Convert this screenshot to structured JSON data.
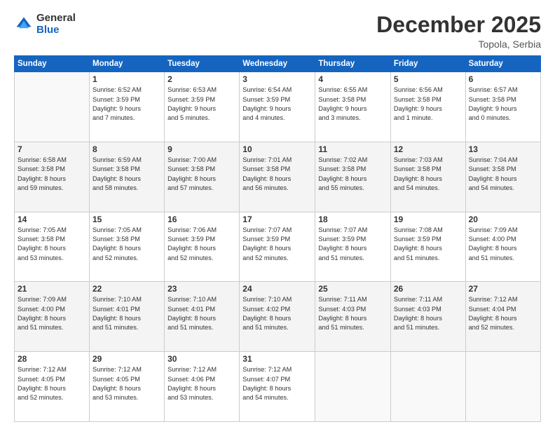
{
  "logo": {
    "general": "General",
    "blue": "Blue"
  },
  "title": "December 2025",
  "subtitle": "Topola, Serbia",
  "days_header": [
    "Sunday",
    "Monday",
    "Tuesday",
    "Wednesday",
    "Thursday",
    "Friday",
    "Saturday"
  ],
  "weeks": [
    [
      {
        "num": "",
        "detail": ""
      },
      {
        "num": "1",
        "detail": "Sunrise: 6:52 AM\nSunset: 3:59 PM\nDaylight: 9 hours\nand 7 minutes."
      },
      {
        "num": "2",
        "detail": "Sunrise: 6:53 AM\nSunset: 3:59 PM\nDaylight: 9 hours\nand 5 minutes."
      },
      {
        "num": "3",
        "detail": "Sunrise: 6:54 AM\nSunset: 3:59 PM\nDaylight: 9 hours\nand 4 minutes."
      },
      {
        "num": "4",
        "detail": "Sunrise: 6:55 AM\nSunset: 3:58 PM\nDaylight: 9 hours\nand 3 minutes."
      },
      {
        "num": "5",
        "detail": "Sunrise: 6:56 AM\nSunset: 3:58 PM\nDaylight: 9 hours\nand 1 minute."
      },
      {
        "num": "6",
        "detail": "Sunrise: 6:57 AM\nSunset: 3:58 PM\nDaylight: 9 hours\nand 0 minutes."
      }
    ],
    [
      {
        "num": "7",
        "detail": "Sunrise: 6:58 AM\nSunset: 3:58 PM\nDaylight: 8 hours\nand 59 minutes."
      },
      {
        "num": "8",
        "detail": "Sunrise: 6:59 AM\nSunset: 3:58 PM\nDaylight: 8 hours\nand 58 minutes."
      },
      {
        "num": "9",
        "detail": "Sunrise: 7:00 AM\nSunset: 3:58 PM\nDaylight: 8 hours\nand 57 minutes."
      },
      {
        "num": "10",
        "detail": "Sunrise: 7:01 AM\nSunset: 3:58 PM\nDaylight: 8 hours\nand 56 minutes."
      },
      {
        "num": "11",
        "detail": "Sunrise: 7:02 AM\nSunset: 3:58 PM\nDaylight: 8 hours\nand 55 minutes."
      },
      {
        "num": "12",
        "detail": "Sunrise: 7:03 AM\nSunset: 3:58 PM\nDaylight: 8 hours\nand 54 minutes."
      },
      {
        "num": "13",
        "detail": "Sunrise: 7:04 AM\nSunset: 3:58 PM\nDaylight: 8 hours\nand 54 minutes."
      }
    ],
    [
      {
        "num": "14",
        "detail": "Sunrise: 7:05 AM\nSunset: 3:58 PM\nDaylight: 8 hours\nand 53 minutes."
      },
      {
        "num": "15",
        "detail": "Sunrise: 7:05 AM\nSunset: 3:58 PM\nDaylight: 8 hours\nand 52 minutes."
      },
      {
        "num": "16",
        "detail": "Sunrise: 7:06 AM\nSunset: 3:59 PM\nDaylight: 8 hours\nand 52 minutes."
      },
      {
        "num": "17",
        "detail": "Sunrise: 7:07 AM\nSunset: 3:59 PM\nDaylight: 8 hours\nand 52 minutes."
      },
      {
        "num": "18",
        "detail": "Sunrise: 7:07 AM\nSunset: 3:59 PM\nDaylight: 8 hours\nand 51 minutes."
      },
      {
        "num": "19",
        "detail": "Sunrise: 7:08 AM\nSunset: 3:59 PM\nDaylight: 8 hours\nand 51 minutes."
      },
      {
        "num": "20",
        "detail": "Sunrise: 7:09 AM\nSunset: 4:00 PM\nDaylight: 8 hours\nand 51 minutes."
      }
    ],
    [
      {
        "num": "21",
        "detail": "Sunrise: 7:09 AM\nSunset: 4:00 PM\nDaylight: 8 hours\nand 51 minutes."
      },
      {
        "num": "22",
        "detail": "Sunrise: 7:10 AM\nSunset: 4:01 PM\nDaylight: 8 hours\nand 51 minutes."
      },
      {
        "num": "23",
        "detail": "Sunrise: 7:10 AM\nSunset: 4:01 PM\nDaylight: 8 hours\nand 51 minutes."
      },
      {
        "num": "24",
        "detail": "Sunrise: 7:10 AM\nSunset: 4:02 PM\nDaylight: 8 hours\nand 51 minutes."
      },
      {
        "num": "25",
        "detail": "Sunrise: 7:11 AM\nSunset: 4:03 PM\nDaylight: 8 hours\nand 51 minutes."
      },
      {
        "num": "26",
        "detail": "Sunrise: 7:11 AM\nSunset: 4:03 PM\nDaylight: 8 hours\nand 51 minutes."
      },
      {
        "num": "27",
        "detail": "Sunrise: 7:12 AM\nSunset: 4:04 PM\nDaylight: 8 hours\nand 52 minutes."
      }
    ],
    [
      {
        "num": "28",
        "detail": "Sunrise: 7:12 AM\nSunset: 4:05 PM\nDaylight: 8 hours\nand 52 minutes."
      },
      {
        "num": "29",
        "detail": "Sunrise: 7:12 AM\nSunset: 4:05 PM\nDaylight: 8 hours\nand 53 minutes."
      },
      {
        "num": "30",
        "detail": "Sunrise: 7:12 AM\nSunset: 4:06 PM\nDaylight: 8 hours\nand 53 minutes."
      },
      {
        "num": "31",
        "detail": "Sunrise: 7:12 AM\nSunset: 4:07 PM\nDaylight: 8 hours\nand 54 minutes."
      },
      {
        "num": "",
        "detail": ""
      },
      {
        "num": "",
        "detail": ""
      },
      {
        "num": "",
        "detail": ""
      }
    ]
  ]
}
